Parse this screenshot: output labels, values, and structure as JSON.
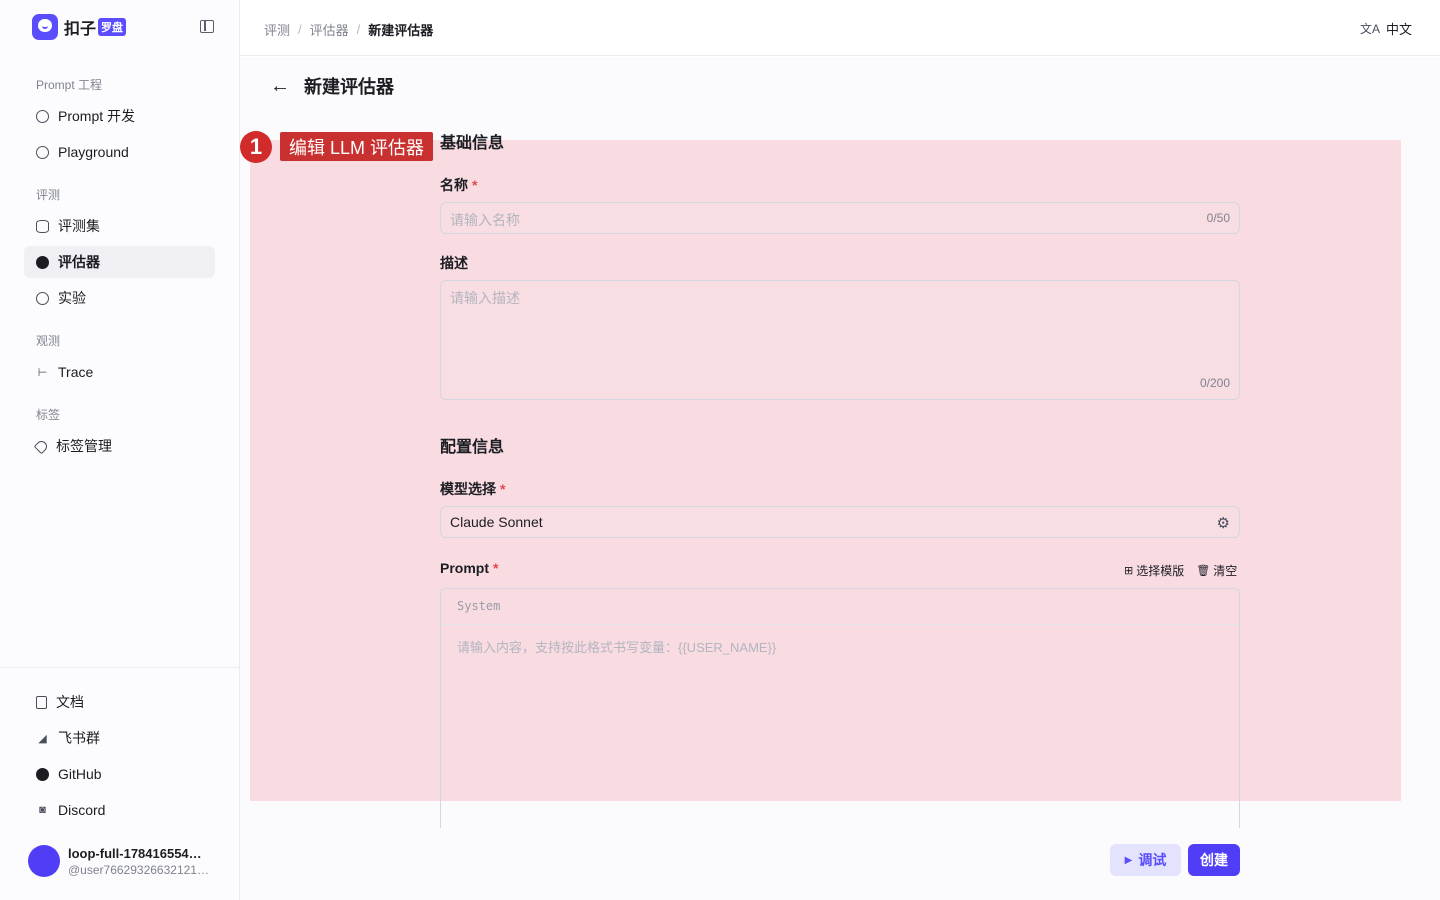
{
  "brand": {
    "name": "扣子",
    "badge": "罗盘"
  },
  "sidebar": {
    "groups": [
      {
        "title": "Prompt 工程",
        "items": [
          {
            "label": "Prompt 开发",
            "icon": "prompt-icon"
          },
          {
            "label": "Playground",
            "icon": "play-icon"
          }
        ]
      },
      {
        "title": "评测",
        "items": [
          {
            "label": "评测集",
            "icon": "database-icon"
          },
          {
            "label": "评估器",
            "icon": "evaluator-icon",
            "active": true
          },
          {
            "label": "实验",
            "icon": "gauge-icon"
          }
        ]
      },
      {
        "title": "观测",
        "items": [
          {
            "label": "Trace",
            "icon": "trace-icon"
          }
        ]
      },
      {
        "title": "标签",
        "items": [
          {
            "label": "标签管理",
            "icon": "tag-icon"
          }
        ]
      }
    ],
    "bottom_items": [
      {
        "label": "文档",
        "icon": "document-icon"
      },
      {
        "label": "飞书群",
        "icon": "feishu-icon"
      },
      {
        "label": "GitHub",
        "icon": "github-icon"
      },
      {
        "label": "Discord",
        "icon": "discord-icon"
      }
    ],
    "user": {
      "name": "loop-full-178416554…",
      "handle": "@user76629326632121…"
    }
  },
  "header": {
    "breadcrumb": [
      "评测",
      "评估器",
      "新建评估器"
    ],
    "language": "中文"
  },
  "page": {
    "title": "新建评估器",
    "annotation": {
      "number": "1",
      "label": "编辑 LLM 评估器"
    },
    "basic_section": "基础信息",
    "name_label": "名称",
    "name_placeholder": "请输入名称",
    "name_counter": "0/50",
    "desc_label": "描述",
    "desc_placeholder": "请输入描述",
    "desc_counter": "0/200",
    "config_section": "配置信息",
    "model_label": "模型选择",
    "model_value": "Claude Sonnet",
    "prompt_label": "Prompt",
    "template_button": "选择模版",
    "clear_button": "清空",
    "prompt_role": "System",
    "prompt_placeholder": "请输入内容，支持按此格式书写变量：{{USER_NAME}}",
    "debug_button": "调试",
    "create_button": "创建"
  },
  "colors": {
    "accent": "#4f3ef5",
    "highlight": "#f4aab4",
    "marker": "#d22b2b",
    "required": "#e5484d"
  }
}
